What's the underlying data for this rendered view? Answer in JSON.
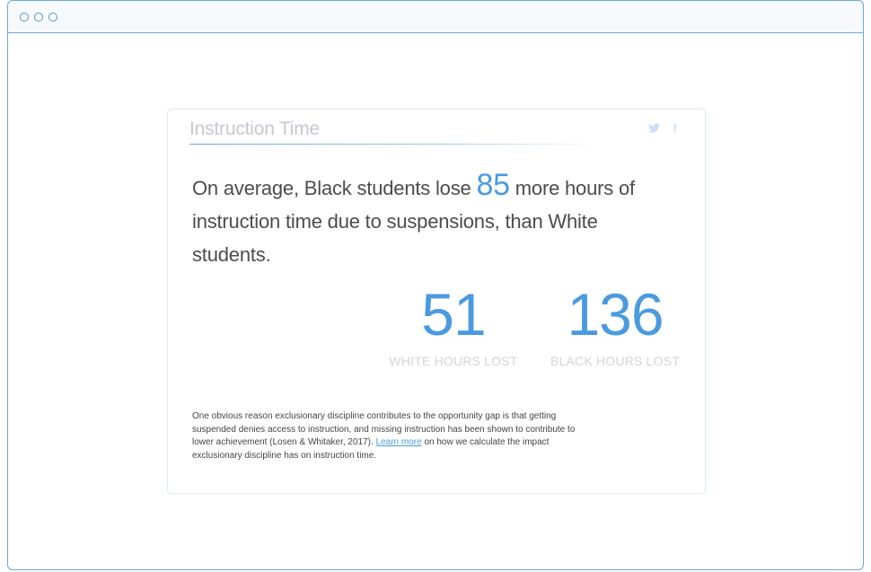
{
  "window": {
    "controls": [
      "window-dot-1",
      "window-dot-2",
      "window-dot-3"
    ]
  },
  "card": {
    "title": "Instruction Time",
    "social": {
      "twitter_icon": "twitter-icon",
      "facebook_icon": "facebook-icon",
      "facebook_glyph": "f",
      "icon_color": "#c9dff3"
    },
    "lead": {
      "part1": "On average, Black students lose ",
      "highlight": "85",
      "part2": " more hours of ",
      "part3": "instruction",
      "part4": " time due to suspensions, than White students."
    },
    "stats": {
      "white": {
        "value": "51",
        "label": "WHITE HOURS LOST"
      },
      "black": {
        "value": "136",
        "label": "BLACK HOURS LOST"
      }
    },
    "footnote": {
      "before_link": "One obvious reason exclusionary discipline contributes to the opportunity gap is that getting suspended denies access to instruction, and missing instruction has been shown to contribute to lower achievement (Losen & Whitaker, 2017). ",
      "link_text": "Learn more",
      "after_link": " on how we calculate the impact exclusionary discipline has on instruction time."
    }
  },
  "colors": {
    "accent": "#4a9ae0",
    "window_border": "#6aa8d8",
    "title_gray": "#c4c9d0",
    "label_gray": "#d1d4d8"
  }
}
